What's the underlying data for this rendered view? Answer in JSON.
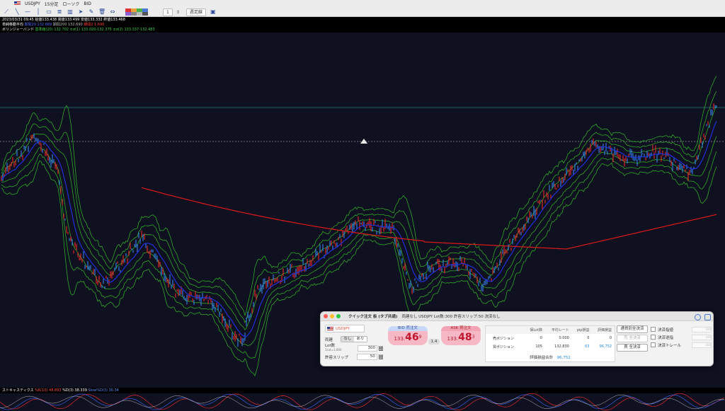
{
  "toolbar": {
    "symbol": "USDJPY",
    "timeframe": "15分足",
    "chart_type": "ローソク",
    "price_type": "BID",
    "count": "1",
    "period": "週足線"
  },
  "info": {
    "line1": "2023/03/31 09:45  始値133.438  高値133.499  安値133.332  終値133.468",
    "ma_label": "単純移動平均",
    "ma_vals": [
      "期間20 132.669",
      "期間200 132.690"
    ],
    "ma_red": "期間2 1.690",
    "bb_label": "ボリンジャーバンド",
    "bb_vals": "基準線(20) 132.702  ±σ(1) 133.020-132.375  ±σ(2) 133.337-132.483"
  },
  "stoch": {
    "label": "ストキャスティクス",
    "k": "%K(10) 48.893",
    "d": "%D(3) 38.339",
    "sd": "Slow%D(3) 30.34"
  },
  "chart_data": {
    "type": "line",
    "series": [
      {
        "name": "candles",
        "color": "#ff2a2a"
      },
      {
        "name": "SMA 20",
        "color": "#2030d8"
      },
      {
        "name": "SMA 200",
        "color": "#e01a1a"
      },
      {
        "name": "Bollinger Bands",
        "color": "#2fa827"
      }
    ],
    "grid": false
  },
  "panel": {
    "title": "クイック注文 板 (タブ共通)",
    "info": "両建なし USDJPY Lot数:300 許容スリップ:50 決済なし",
    "symbol": "USDJPY",
    "hedge_label": "両建",
    "hedge_off": "なし",
    "hedge_on": "あり",
    "lot_label": "Lot数",
    "lot_sub": "1Lot=1,000",
    "lot_value": "300",
    "slip_label": "許容スリップ",
    "slip_value": "50",
    "bid_label": "BID 売注文",
    "bid_pre": "133.",
    "bid_big": "46",
    "bid_sup": "9",
    "ask_label": "ASK 買注文",
    "ask_pre": "133.",
    "ask_big": "48",
    "ask_sup": "3",
    "spread": "1.4",
    "table": {
      "headers": [
        "",
        "保Lot数",
        "平均レート",
        "pip損益",
        "評価損益"
      ],
      "rows": [
        [
          "売ポジション",
          "0",
          "0.000",
          "0",
          "0"
        ],
        [
          "買ポジション",
          "105",
          "132.830",
          "63",
          "96,752"
        ]
      ],
      "total_label": "評価損益合計",
      "total_value": "96,752"
    },
    "btn_per_pair": "通貨別全決済",
    "btn_all_sell": "売 全決済",
    "btn_all_buy": "買 全決済",
    "ck_limit": "決済指値",
    "ck_stop": "決済逆指",
    "ck_trail": "決済トレール",
    "ck_limit_val": "100",
    "ck_stop_val": "100",
    "ck_trail_val": "100"
  },
  "colors": {
    "accent": "#2fa827",
    "bid": "#c0152c"
  }
}
